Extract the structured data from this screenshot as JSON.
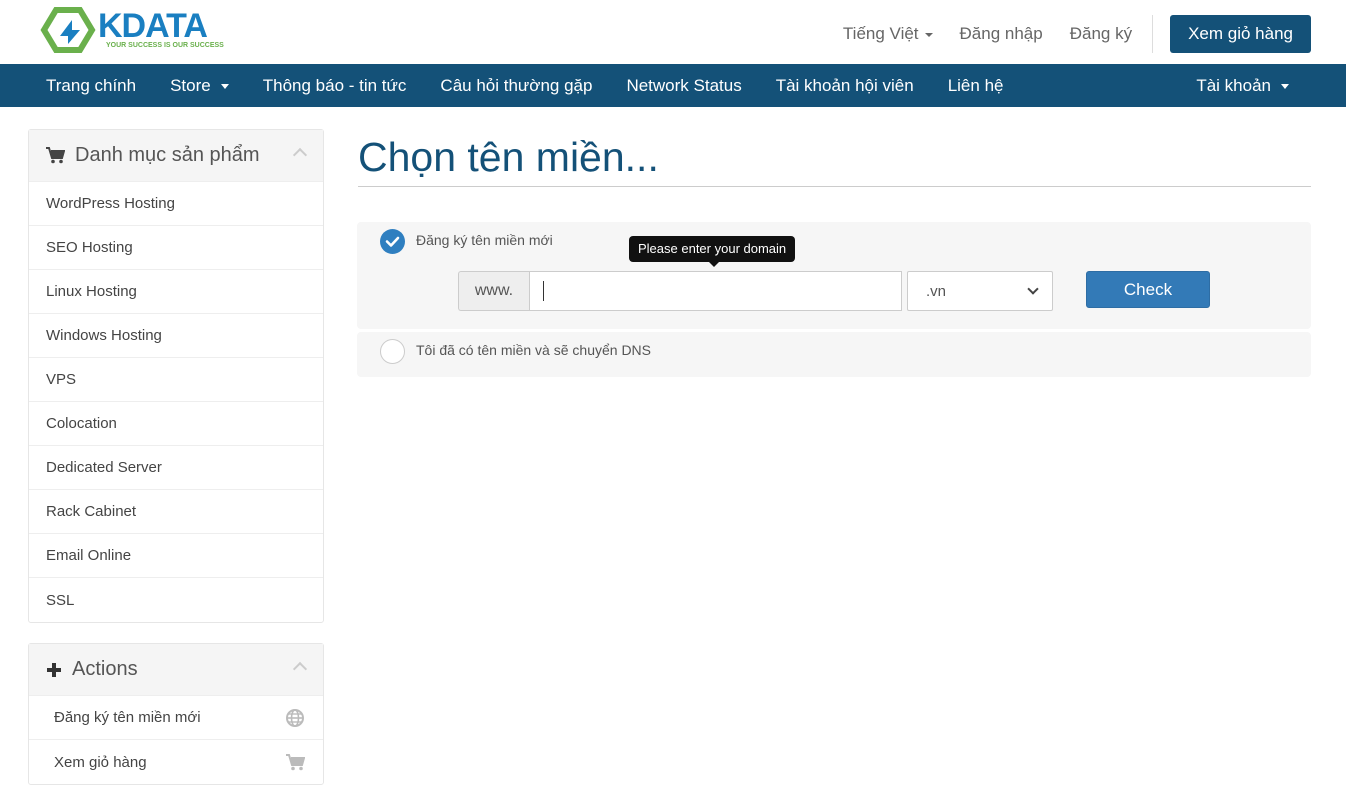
{
  "brand": {
    "name": "KDATA",
    "tagline": "YOUR SUCCESS IS OUR SUCCESS",
    "primary_color": "#145178",
    "logo_green": "#6ab04c",
    "logo_blue": "#1a7fc1"
  },
  "top_links": {
    "language": "Tiếng Việt",
    "login": "Đăng nhập",
    "register": "Đăng ký",
    "cart_button": "Xem giỏ hàng"
  },
  "nav": {
    "items": [
      {
        "label": "Trang chính",
        "dropdown": false
      },
      {
        "label": "Store",
        "dropdown": true
      },
      {
        "label": "Thông báo - tin tức",
        "dropdown": false
      },
      {
        "label": "Câu hỏi thường gặp",
        "dropdown": false
      },
      {
        "label": "Network Status",
        "dropdown": false
      },
      {
        "label": "Tài khoản hội viên",
        "dropdown": false
      },
      {
        "label": "Liên hệ",
        "dropdown": false
      }
    ],
    "account": "Tài khoản"
  },
  "sidebar": {
    "categories": {
      "title": "Danh mục sản phẩm",
      "icon": "cart-icon",
      "items": [
        "WordPress Hosting",
        "SEO Hosting",
        "Linux Hosting",
        "Windows Hosting",
        "VPS",
        "Colocation",
        "Dedicated Server",
        "Rack Cabinet",
        "Email Online",
        "SSL"
      ]
    },
    "actions": {
      "title": "Actions",
      "icon": "plus-icon",
      "items": [
        {
          "label": "Đăng ký tên miền mới",
          "icon": "globe-icon"
        },
        {
          "label": "Xem giỏ hàng",
          "icon": "cart-icon"
        }
      ]
    }
  },
  "main": {
    "title": "Chọn tên miền...",
    "option_register": {
      "label": "Đăng ký tên miền mới",
      "selected": true,
      "tooltip": "Please enter your domain",
      "prefix": "www.",
      "input_value": "",
      "tld_selected": ".vn",
      "check_button": "Check"
    },
    "option_transfer": {
      "label": "Tôi đã có tên miền và sẽ chuyển DNS",
      "selected": false
    }
  }
}
